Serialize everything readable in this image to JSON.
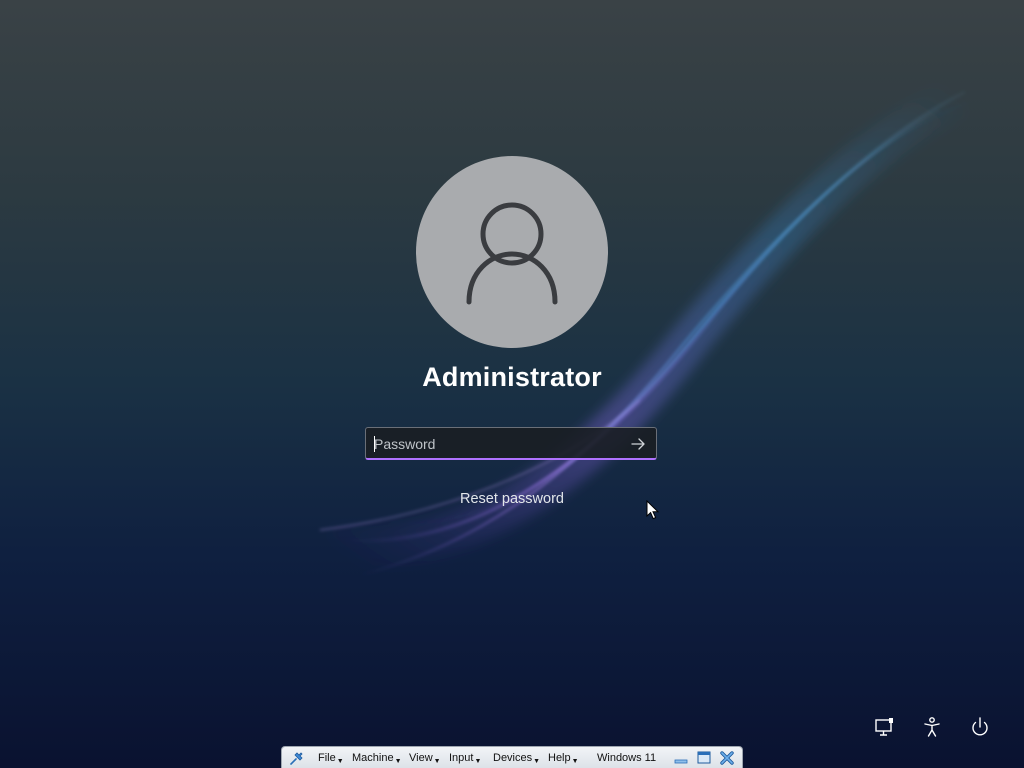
{
  "lock_screen": {
    "username": "Administrator",
    "password_placeholder": "Password",
    "password_value": "",
    "reset_password_label": "Reset password",
    "icons": {
      "avatar": "user-silhouette-icon",
      "submit": "arrow-right-icon",
      "network": "network-icon",
      "accessibility": "accessibility-icon",
      "power": "power-icon"
    },
    "colors": {
      "focus_underline": "#b072ff",
      "avatar_background": "#a9abae"
    }
  },
  "vbox_toolbar": {
    "menus": [
      "File",
      "Machine",
      "View",
      "Input",
      "Devices",
      "Help"
    ],
    "vm_name": "Windows 11",
    "icons": {
      "pin": "pin-icon",
      "minimize": "minimize-icon",
      "restore": "restore-window-icon",
      "close": "close-icon"
    }
  }
}
